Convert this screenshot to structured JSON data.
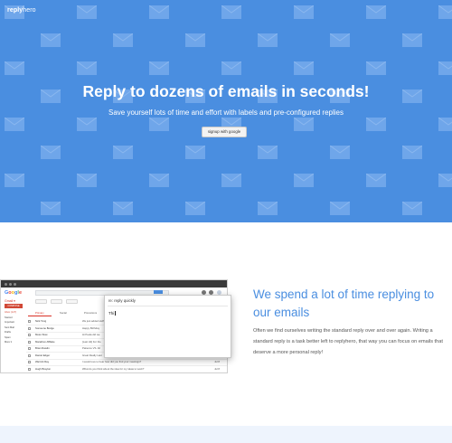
{
  "colors": {
    "hero_bg": "#4a8ee0",
    "accent": "#4a8ee0",
    "text_dark": "#555555"
  },
  "brand": {
    "part1": "reply",
    "part2": "hero"
  },
  "hero": {
    "title": "Reply to dozens of emails in seconds!",
    "subtitle": "Save yourself lots of time and effort with labels and pre-configured replies",
    "signup_label": "signup with google"
  },
  "screenshot": {
    "logo": "Google",
    "gmail_label": "Gmail ▾",
    "compose_label": "COMPOSE",
    "sidebar": [
      "Inbox (127)",
      "Starred",
      "Important",
      "Sent Mail",
      "Drafts",
      "Spam",
      "More ▾"
    ],
    "tabs": [
      "Primary",
      "Social",
      "Promotions"
    ],
    "rows": [
      {
        "sender": "Nick Tong",
        "subject": "We just added stuff",
        "date": "8:34 am"
      },
      {
        "sender": "Someone Bodge",
        "subject": "Happy Birthday",
        "date": "8:00 am"
      },
      {
        "sender": "Moss Slow",
        "subject": "Hi Paula did we",
        "date": "Jul 12"
      },
      {
        "sender": "Marathon Affiliate",
        "subject": "[Last Hit] For the",
        "date": "Jul 11"
      },
      {
        "sender": "Brian Rawlin",
        "subject": "Patience VS. All",
        "date": "Jul 10"
      },
      {
        "sender": "Daniel Edger",
        "subject": "Great Really Last",
        "date": "Jul 9"
      },
      {
        "sender": "Warrick Ray",
        "subject": "I would love to hear how did you find your meetings?",
        "date": "Jul 8"
      },
      {
        "sender": "Hugh Brayton",
        "subject": "What do you think about the idea for my ideas to work?",
        "date": "Jul 8"
      }
    ],
    "reply_subject": "re: reply quickly",
    "reply_body": "Thi"
  },
  "section": {
    "title": "We spend a lot of time replying to our emails",
    "body": "Often we find ourselves writing the standard reply over and over again. Writing a standard reply is a task better left to replyhero, that way you can focus on emails that deserve a more personal reply!"
  }
}
